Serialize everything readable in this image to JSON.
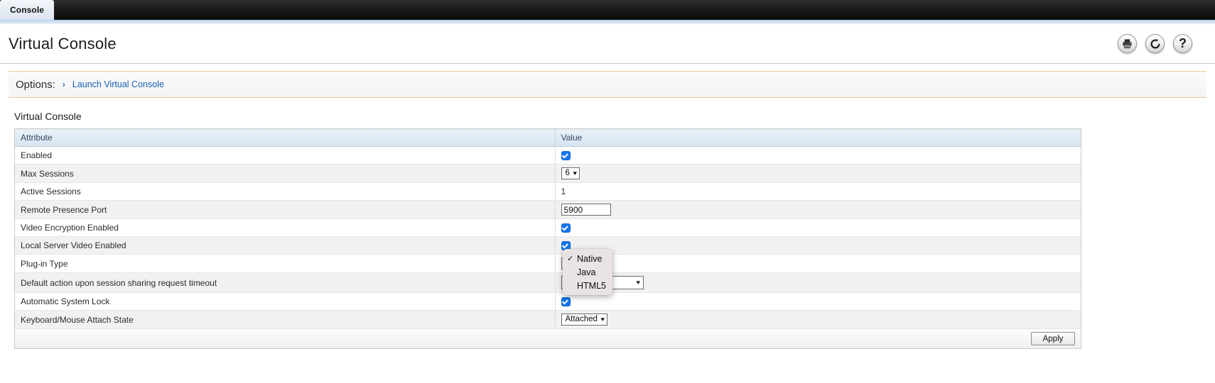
{
  "browser": {
    "tab_label": "Console"
  },
  "header": {
    "title": "Virtual Console",
    "icons": [
      {
        "name": "print-icon",
        "label": "Print"
      },
      {
        "name": "refresh-icon",
        "label": "Refresh"
      },
      {
        "name": "help-icon",
        "label": "Help",
        "glyph": "?"
      }
    ]
  },
  "options_bar": {
    "label": "Options:",
    "chevron": "›",
    "link": "Launch Virtual Console"
  },
  "section": {
    "title": "Virtual Console",
    "table": {
      "columns": [
        "Attribute",
        "Value"
      ],
      "rows": [
        {
          "attribute": "Enabled",
          "control": "checkbox",
          "checked": true
        },
        {
          "attribute": "Max Sessions",
          "control": "select",
          "value": "6"
        },
        {
          "attribute": "Active Sessions",
          "control": "text",
          "value": "1"
        },
        {
          "attribute": "Remote Presence Port",
          "control": "input",
          "value": "5900"
        },
        {
          "attribute": "Video Encryption Enabled",
          "control": "checkbox",
          "checked": true
        },
        {
          "attribute": "Local Server Video Enabled",
          "control": "checkbox",
          "checked": true
        },
        {
          "attribute": "Plug-in Type",
          "control": "select",
          "value": "Native"
        },
        {
          "attribute": "Default action upon session sharing request timeout",
          "control": "select-wide",
          "value": ""
        },
        {
          "attribute": "Automatic System Lock",
          "control": "checkbox",
          "checked": true
        },
        {
          "attribute": "Keyboard/Mouse Attach State",
          "control": "select",
          "value": "Attached"
        }
      ]
    },
    "apply_label": "Apply"
  },
  "open_dropdown": {
    "for_row": "Plug-in Type",
    "checkmark": "✓",
    "items": [
      {
        "label": "Native",
        "selected": true
      },
      {
        "label": "Java",
        "selected": false
      },
      {
        "label": "HTML5",
        "selected": false
      }
    ]
  },
  "colors": {
    "link": "#1761b5",
    "accent_checkbox": "#1276f0",
    "options_border": "#e3cf8f",
    "table_header": "#d5e4f1"
  }
}
